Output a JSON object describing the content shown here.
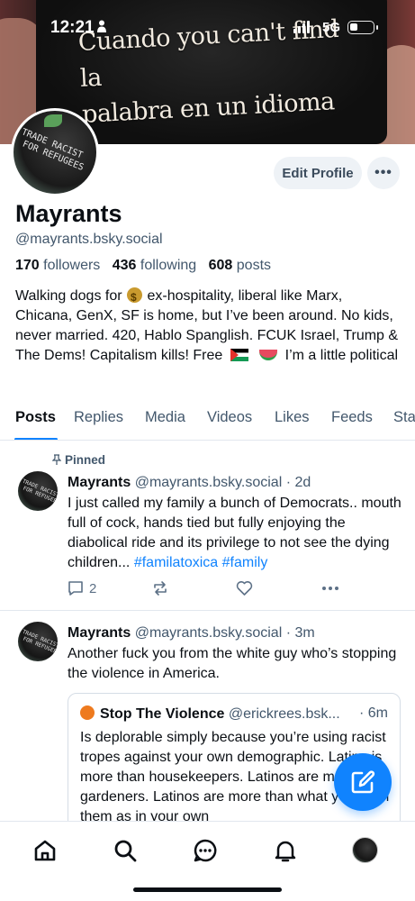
{
  "status_bar": {
    "time": "12:21",
    "network": "5G"
  },
  "banner": {
    "mug_text": "Cuando you can't find la\npalabra en un idioma so\nyou fill it in con la otra."
  },
  "profile": {
    "avatar_text": "TRADE RACIST\n FOR REFUGEES",
    "edit_label": "Edit Profile",
    "more_label": "•••",
    "display_name": "Mayrants",
    "handle": "@mayrants.bsky.social",
    "followers_count": "170",
    "followers_label": "followers",
    "following_count": "436",
    "following_label": "following",
    "posts_count": "608",
    "posts_label": "posts",
    "bio": {
      "part1": "Walking dogs for",
      "part2": "ex-hospitality, liberal like Marx, Chicana, GenX, SF is home, but I’ve been around. No kids, never married. 420, Hablo Spanglish. FCUK Israel, Trump & The Dems! Capitalism kills! Free",
      "part3": "I’m a little political"
    }
  },
  "tabs": [
    "Posts",
    "Replies",
    "Media",
    "Videos",
    "Likes",
    "Feeds",
    "Sta"
  ],
  "posts": [
    {
      "pinned_label": "Pinned",
      "author": "Mayrants",
      "handle": "@mayrants.bsky.social",
      "time": "· 2d",
      "text": "I just called my family a bunch of Democrats.. mouth full of cock, hands tied but fully enjoying the diabolical ride and its privilege to not see the dying children...",
      "tag1": "#familatoxica",
      "tag2": "#family",
      "reply_count": "2"
    },
    {
      "author": "Mayrants",
      "handle": "@mayrants.bsky.social",
      "time": "· 3m",
      "text": "Another fuck you from the white guy who’s stopping the violence in America.",
      "quote": {
        "author": "Stop The Violence",
        "handle": "@erickrees.bsk...",
        "time": "· 6m",
        "text": "Is deplorable simply because you’re using racist tropes against your own demographic. Latino is more than housekeepers. Latinos are more than gardeners. Latinos are more than what you label them as in your own"
      }
    }
  ],
  "colors": {
    "accent": "#1083fe",
    "muted": "#42576c",
    "border": "#e2e7ee"
  }
}
